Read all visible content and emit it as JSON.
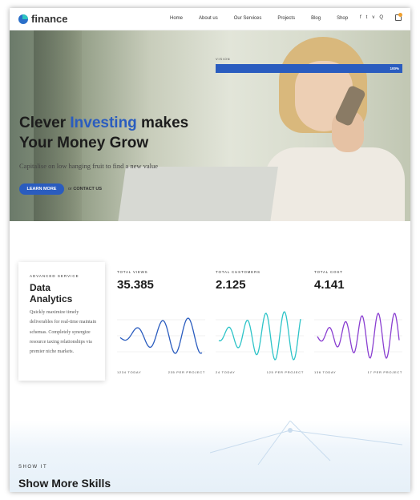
{
  "header": {
    "logo_text": "finance",
    "nav": [
      "Home",
      "About us",
      "Our Services",
      "Projects",
      "Blog",
      "Shop"
    ],
    "social": [
      "f",
      "t",
      "v",
      "Q"
    ]
  },
  "hero": {
    "title_line1_start": "Clever ",
    "title_accent": "Investing",
    "title_line1_end": " makes",
    "title_line2": "Your Money Grow",
    "subtitle": "Capitalise on low hanging fruit to find a new value",
    "button_label": "LEARN MORE",
    "or_text": "or",
    "contact_label": "CONTACT US"
  },
  "service_card": {
    "kicker": "ADVANCED SERVICE",
    "title_line1": "Data",
    "title_line2": "Analytics",
    "text": "Quickly maximize timely deliverables for real-time maintain schemas. Completely synergize resource taxing relationships via premier niche markets."
  },
  "stats": [
    {
      "label": "TOTAL VIEWS",
      "value": "35.385",
      "foot_left": "1234 TODAY",
      "foot_right": "235 PER PROJECT",
      "color": "#2a5cbf"
    },
    {
      "label": "TOTAL CUSTOMERS",
      "value": "2.125",
      "foot_left": "24 TODAY",
      "foot_right": "125 PER PROJECT",
      "color": "#2ec4c8"
    },
    {
      "label": "TOTAL COST",
      "value": "4.141",
      "foot_left": "136 TODAY",
      "foot_right": "17 PER PROJECT",
      "color": "#8a3fd1"
    }
  ],
  "skills": {
    "kicker": "SHOW IT",
    "title": "Show More Skills",
    "bars": [
      {
        "label": "VISION",
        "percent": 100,
        "percent_label": "100%"
      }
    ]
  }
}
